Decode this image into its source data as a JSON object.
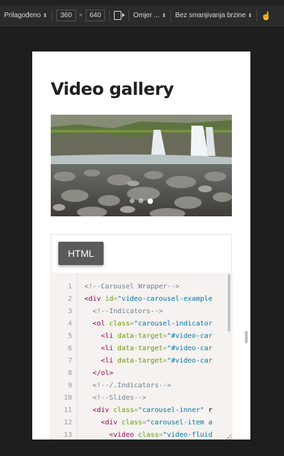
{
  "toolbar": {
    "device_label": "Prilagođeno",
    "width_value": "360",
    "times": "×",
    "height_value": "640",
    "ratio_label": "Omjer ...",
    "throttle_label": "Bez smanjivanja brzine"
  },
  "page": {
    "title": "Video gallery"
  },
  "carousel": {
    "indicator_count": 3,
    "active_index": 2
  },
  "code_card": {
    "tab_label": "HTML",
    "line_numbers": [
      "1",
      "2",
      "3",
      "4",
      "5",
      "6",
      "7",
      "8",
      "9",
      "10",
      "11",
      "12",
      "13"
    ],
    "lines": [
      "<!--Carousel Wrapper-->",
      "<div id=\"video-carousel-example",
      "  <!--Indicators-->",
      "  <ol class=\"carousel-indicator",
      "    <li data-target=\"#video-car",
      "    <li data-target=\"#video-car",
      "    <li data-target=\"#video-car",
      "  </ol>",
      "  <!--/.Indicators-->",
      "  <!--Slides-->",
      "  <div class=\"carousel-inner\" r",
      "    <div class=\"carousel-item a",
      "      <video class=\"video-fluid"
    ]
  },
  "colors": {
    "comment": "#708090",
    "tag": "#990055",
    "attr": "#669900",
    "string": "#0077aa"
  }
}
